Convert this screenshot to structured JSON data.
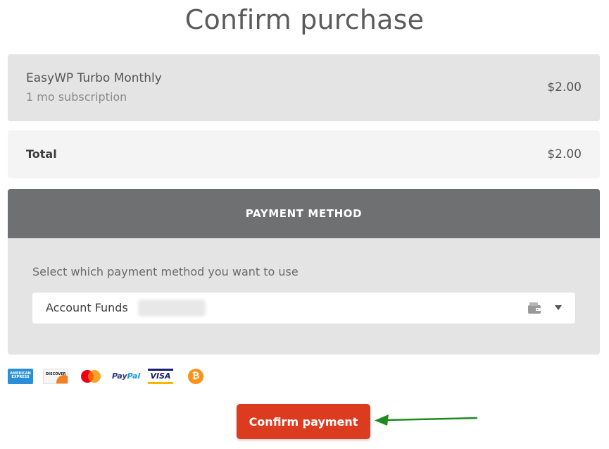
{
  "page": {
    "title": "Confirm purchase"
  },
  "order": {
    "product_name": "EasyWP Turbo Monthly",
    "product_term": "1 mo subscription",
    "product_price": "$2.00",
    "total_label": "Total",
    "total_value": "$2.00"
  },
  "payment": {
    "header": "PAYMENT METHOD",
    "instruction": "Select which payment method you want to use",
    "selected_method": "Account Funds",
    "card_logos": [
      "american-express-logo",
      "discover-logo",
      "mastercard-logo",
      "paypal-logo",
      "visa-logo",
      "bitcoin-logo"
    ]
  },
  "actions": {
    "confirm_label": "Confirm payment"
  },
  "colors": {
    "accent": "#dd3b1f",
    "header_bg": "#6f7072",
    "panel_bg": "#e4e4e5",
    "annotation_arrow": "#1f8a1f"
  }
}
